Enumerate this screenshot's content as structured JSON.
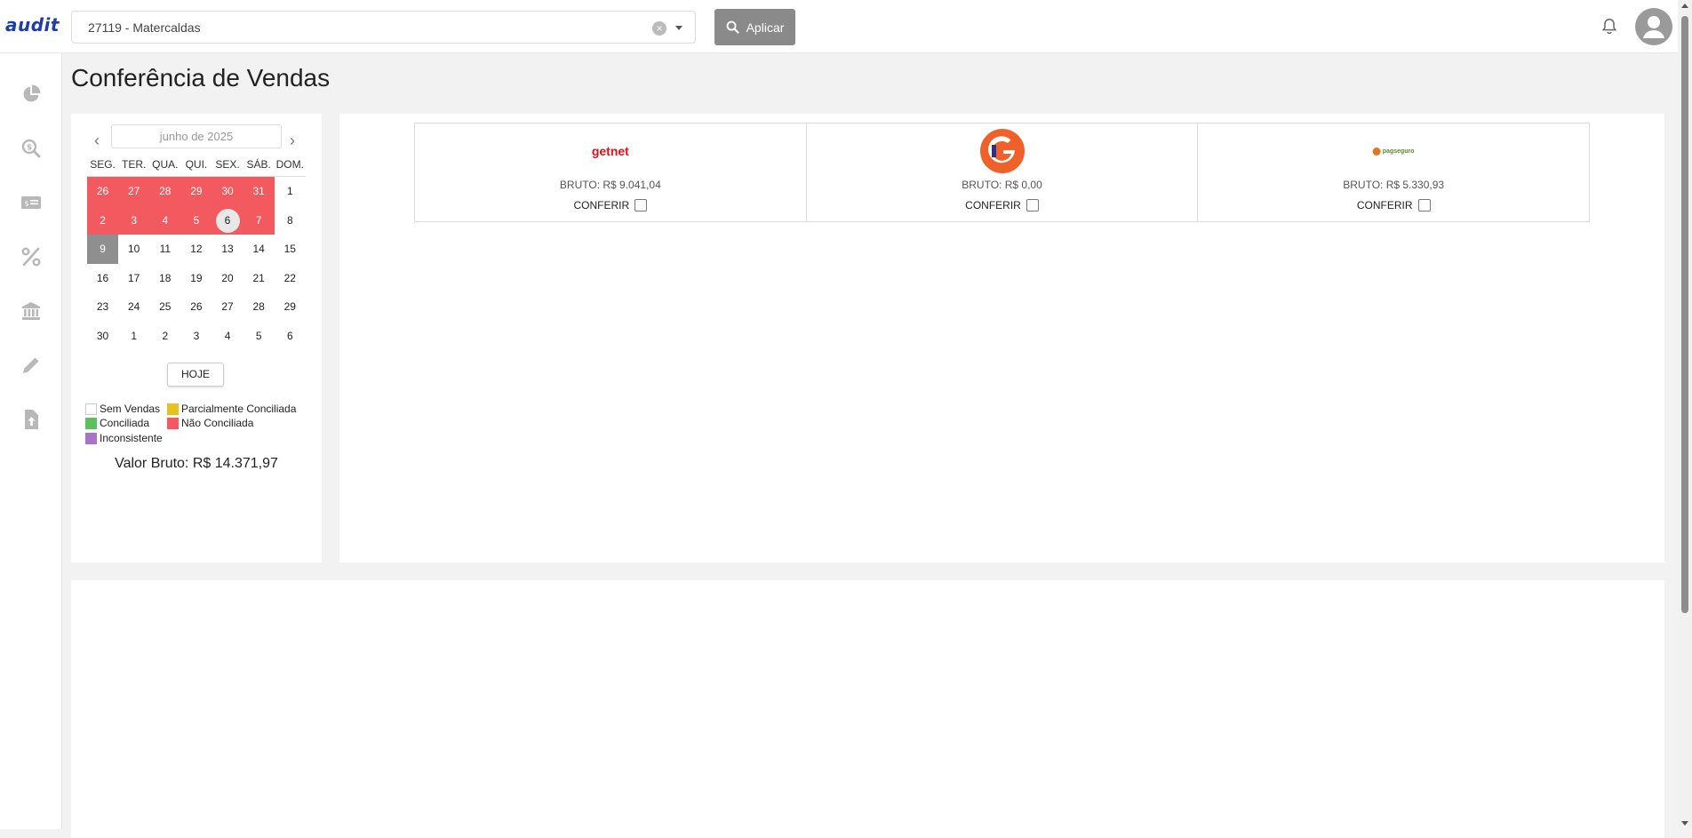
{
  "app": {
    "logo_text": "audit"
  },
  "topbar": {
    "store_select_value": "27119 - Matercaldas",
    "apply_label": "Aplicar"
  },
  "page": {
    "title": "Conferência de Vendas"
  },
  "calendar": {
    "month_label": "junho de 2025",
    "weekdays": [
      "SEG.",
      "TER.",
      "QUA.",
      "QUI.",
      "SEX.",
      "SÁB.",
      "DOM."
    ],
    "rows": [
      [
        "26",
        "27",
        "28",
        "29",
        "30",
        "31",
        "1"
      ],
      [
        "2",
        "3",
        "4",
        "5",
        "6",
        "7",
        "8"
      ],
      [
        "9",
        "10",
        "11",
        "12",
        "13",
        "14",
        "15"
      ],
      [
        "16",
        "17",
        "18",
        "19",
        "20",
        "21",
        "22"
      ],
      [
        "23",
        "24",
        "25",
        "26",
        "27",
        "28",
        "29"
      ],
      [
        "30",
        "1",
        "2",
        "3",
        "4",
        "5",
        "6"
      ]
    ],
    "today_label": "HOJE"
  },
  "legend": {
    "sem_vendas": "Sem Vendas",
    "parcial": "Parcialmente Conciliada",
    "conciliada": "Conciliada",
    "nao_conciliada": "Não Conciliada",
    "inconsistente": "Inconsistente",
    "colors": {
      "sem_vendas": "#ffffff",
      "parcial": "#e6c21e",
      "conciliada": "#5cc05c",
      "nao_conciliada": "#f25a5f",
      "inconsistente": "#a874c8"
    }
  },
  "summary": {
    "valor_bruto": "Valor Bruto: R$ 14.371,97"
  },
  "acquirers": [
    {
      "logo_text": "getnet",
      "logo_icon": "getnet-logo",
      "bruto": "BRUTO: R$ 9.041,04",
      "conferir": "CONFERIR"
    },
    {
      "logo_icon": "g-circle-logo",
      "bruto": "BRUTO: R$ 0,00",
      "conferir": "CONFERIR"
    },
    {
      "logo_text": "pagseguro",
      "logo_icon": "pagseguro-logo",
      "bruto": "BRUTO: R$ 5.330,93",
      "conferir": "CONFERIR"
    }
  ],
  "sidebar": {
    "icons": [
      "pie-chart-icon",
      "search-dollar-icon",
      "money-card-icon",
      "percent-icon",
      "bank-icon",
      "pencil-icon",
      "file-upload-icon"
    ]
  }
}
